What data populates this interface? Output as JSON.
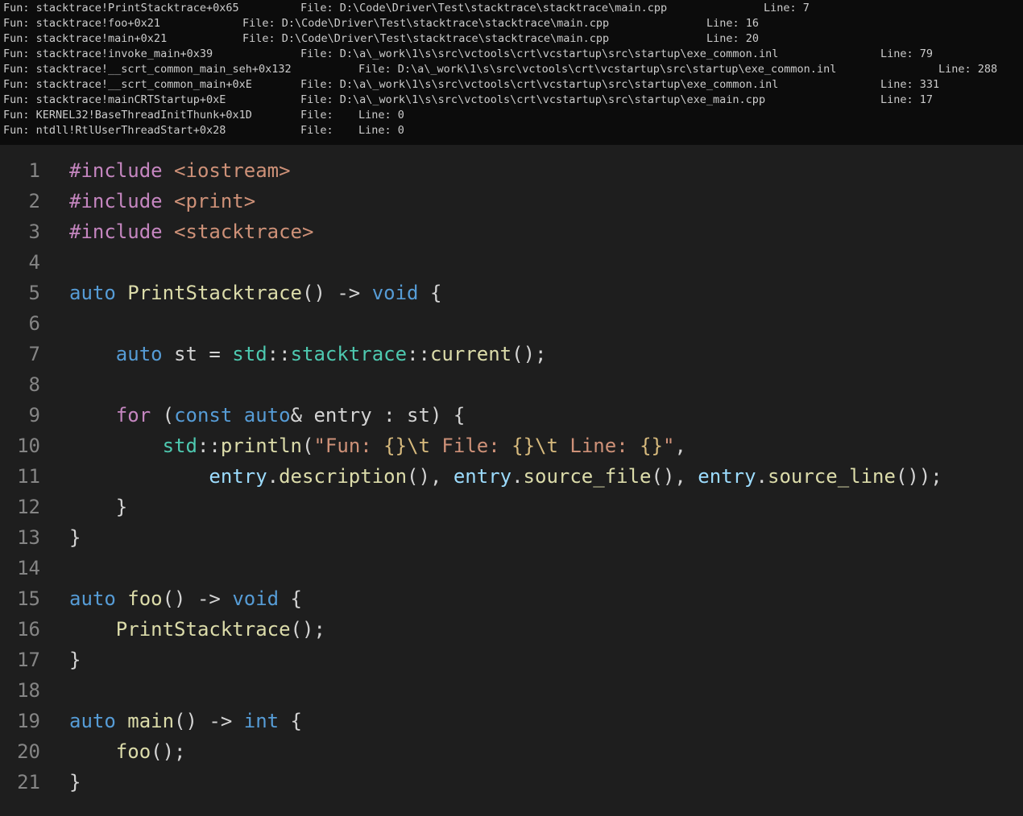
{
  "terminal": {
    "rows": [
      {
        "fun": "Fun: stacktrace!PrintStacktrace+0x65",
        "file": "File: D:\\Code\\Driver\\Test\\stacktrace\\stacktrace\\main.cpp",
        "line": "Line: 7"
      },
      {
        "fun": "Fun: stacktrace!foo+0x21",
        "file": "File: D:\\Code\\Driver\\Test\\stacktrace\\stacktrace\\main.cpp",
        "line": "Line: 16"
      },
      {
        "fun": "Fun: stacktrace!main+0x21",
        "file": "File: D:\\Code\\Driver\\Test\\stacktrace\\stacktrace\\main.cpp",
        "line": "Line: 20"
      },
      {
        "fun": "Fun: stacktrace!invoke_main+0x39",
        "file": "File: D:\\a\\_work\\1\\s\\src\\vctools\\crt\\vcstartup\\src\\startup\\exe_common.inl",
        "line": "Line: 79"
      },
      {
        "fun": "Fun: stacktrace!__scrt_common_main_seh+0x132",
        "file": "File: D:\\a\\_work\\1\\s\\src\\vctools\\crt\\vcstartup\\src\\startup\\exe_common.inl",
        "line": "Line: 288"
      },
      {
        "fun": "Fun: stacktrace!__scrt_common_main+0xE",
        "file": "File: D:\\a\\_work\\1\\s\\src\\vctools\\crt\\vcstartup\\src\\startup\\exe_common.inl",
        "line": "Line: 331"
      },
      {
        "fun": "Fun: stacktrace!mainCRTStartup+0xE",
        "file": "File: D:\\a\\_work\\1\\s\\src\\vctools\\crt\\vcstartup\\src\\startup\\exe_main.cpp",
        "line": "Line: 17"
      },
      {
        "fun": "Fun: KERNEL32!BaseThreadInitThunk+0x1D",
        "file": "File:",
        "line": "Line: 0"
      },
      {
        "fun": "Fun: ntdll!RtlUserThreadStart+0x28",
        "file": "File:",
        "line": "Line: 0"
      }
    ]
  },
  "editor": {
    "colors": {
      "background": "#1e1e1e",
      "line_number": "#858585",
      "preprocessor": "#c586c0",
      "include_path": "#ce9178",
      "keyword": "#569cd6",
      "function": "#dcdcaa",
      "namespace": "#4ec9b0",
      "variable": "#9cdcfe",
      "string": "#ce9178",
      "escape": "#d7ba7d"
    },
    "lines": [
      {
        "num": "1",
        "tokens": [
          [
            "pre",
            "#include"
          ],
          [
            "p",
            " "
          ],
          [
            "inc",
            "<iostream>"
          ]
        ]
      },
      {
        "num": "2",
        "tokens": [
          [
            "pre",
            "#include"
          ],
          [
            "p",
            " "
          ],
          [
            "inc",
            "<print>"
          ]
        ]
      },
      {
        "num": "3",
        "tokens": [
          [
            "pre",
            "#include"
          ],
          [
            "p",
            " "
          ],
          [
            "inc",
            "<stacktrace>"
          ]
        ]
      },
      {
        "num": "4",
        "tokens": []
      },
      {
        "num": "5",
        "tokens": [
          [
            "kw",
            "auto"
          ],
          [
            "p",
            " "
          ],
          [
            "fn",
            "PrintStacktrace"
          ],
          [
            "p",
            "() -> "
          ],
          [
            "kw",
            "void"
          ],
          [
            "p",
            " {"
          ]
        ]
      },
      {
        "num": "6",
        "tokens": []
      },
      {
        "num": "7",
        "tokens": [
          [
            "p",
            "    "
          ],
          [
            "kw",
            "auto"
          ],
          [
            "p",
            " st = "
          ],
          [
            "ns",
            "std"
          ],
          [
            "p",
            "::"
          ],
          [
            "ns",
            "stacktrace"
          ],
          [
            "p",
            "::"
          ],
          [
            "fn",
            "current"
          ],
          [
            "p",
            "();"
          ]
        ]
      },
      {
        "num": "8",
        "tokens": []
      },
      {
        "num": "9",
        "tokens": [
          [
            "p",
            "    "
          ],
          [
            "ctl",
            "for"
          ],
          [
            "p",
            " ("
          ],
          [
            "kw",
            "const"
          ],
          [
            "p",
            " "
          ],
          [
            "kw",
            "auto"
          ],
          [
            "p",
            "& entry : st) {"
          ]
        ]
      },
      {
        "num": "10",
        "tokens": [
          [
            "p",
            "        "
          ],
          [
            "ns",
            "std"
          ],
          [
            "p",
            "::"
          ],
          [
            "fn",
            "println"
          ],
          [
            "p",
            "("
          ],
          [
            "str",
            "\"Fun: "
          ],
          [
            "fmt",
            "{}"
          ],
          [
            "esc",
            "\\t"
          ],
          [
            "str",
            " File: "
          ],
          [
            "fmt",
            "{}"
          ],
          [
            "esc",
            "\\t"
          ],
          [
            "str",
            " Line: "
          ],
          [
            "fmt",
            "{}"
          ],
          [
            "str",
            "\""
          ],
          [
            "p",
            ","
          ]
        ]
      },
      {
        "num": "11",
        "tokens": [
          [
            "p",
            "            "
          ],
          [
            "var",
            "entry"
          ],
          [
            "p",
            "."
          ],
          [
            "fn",
            "description"
          ],
          [
            "p",
            "(), "
          ],
          [
            "var",
            "entry"
          ],
          [
            "p",
            "."
          ],
          [
            "fn",
            "source_file"
          ],
          [
            "p",
            "(), "
          ],
          [
            "var",
            "entry"
          ],
          [
            "p",
            "."
          ],
          [
            "fn",
            "source_line"
          ],
          [
            "p",
            "());"
          ]
        ]
      },
      {
        "num": "12",
        "tokens": [
          [
            "p",
            "    }"
          ]
        ]
      },
      {
        "num": "13",
        "tokens": [
          [
            "p",
            "}"
          ]
        ]
      },
      {
        "num": "14",
        "tokens": []
      },
      {
        "num": "15",
        "tokens": [
          [
            "kw",
            "auto"
          ],
          [
            "p",
            " "
          ],
          [
            "fn",
            "foo"
          ],
          [
            "p",
            "() -> "
          ],
          [
            "kw",
            "void"
          ],
          [
            "p",
            " {"
          ]
        ]
      },
      {
        "num": "16",
        "tokens": [
          [
            "p",
            "    "
          ],
          [
            "fn",
            "PrintStacktrace"
          ],
          [
            "p",
            "();"
          ]
        ]
      },
      {
        "num": "17",
        "tokens": [
          [
            "p",
            "}"
          ]
        ]
      },
      {
        "num": "18",
        "tokens": []
      },
      {
        "num": "19",
        "tokens": [
          [
            "kw",
            "auto"
          ],
          [
            "p",
            " "
          ],
          [
            "fn",
            "main"
          ],
          [
            "p",
            "() -> "
          ],
          [
            "kw",
            "int"
          ],
          [
            "p",
            " {"
          ]
        ]
      },
      {
        "num": "20",
        "tokens": [
          [
            "p",
            "    "
          ],
          [
            "fn",
            "foo"
          ],
          [
            "p",
            "();"
          ]
        ]
      },
      {
        "num": "21",
        "tokens": [
          [
            "p",
            "}"
          ]
        ]
      }
    ]
  }
}
